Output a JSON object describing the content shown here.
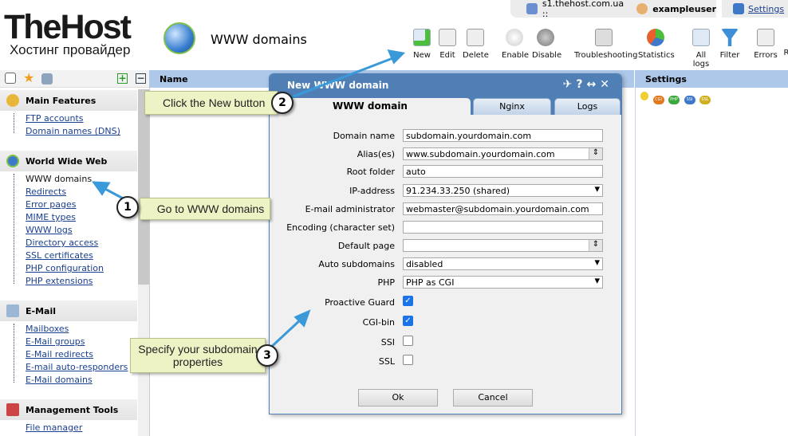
{
  "topbar": {
    "server": "s1.thehost.com.ua ::",
    "user": "exampleuser",
    "settings": "Settings"
  },
  "logo": {
    "name": "TheHost",
    "tagline": "Хостинг провайдер"
  },
  "page_title": "WWW domains",
  "toolbar": [
    "New",
    "Edit",
    "Delete",
    "Enable",
    "Disable",
    "Troubleshooting",
    "Statistics",
    "All logs",
    "Filter",
    "Errors",
    "R"
  ],
  "sidebar": {
    "sections": [
      {
        "title": "Main Features",
        "items": [
          "FTP accounts",
          "Domain names (DNS)"
        ]
      },
      {
        "title": "World Wide Web",
        "items": [
          "WWW domains",
          "Redirects",
          "Error pages",
          "MIME types",
          "WWW logs",
          "Directory access",
          "SSL certificates",
          "PHP configuration",
          "PHP extensions"
        ]
      },
      {
        "title": "E-Mail",
        "items": [
          "Mailboxes",
          "E-Mail groups",
          "E-Mail redirects",
          "E-mail auto-responders",
          "E-Mail domains"
        ]
      },
      {
        "title": "Management Tools",
        "items": [
          "File manager"
        ]
      }
    ]
  },
  "table": {
    "column": "Name"
  },
  "settings_panel": {
    "title": "Settings",
    "chips": [
      "CGI",
      "PHP",
      "SSI",
      "SSL"
    ]
  },
  "dialog": {
    "title": "New WWW domain",
    "tabs": [
      "WWW domain",
      "Nginx",
      "Logs"
    ],
    "fields": {
      "domain_name": {
        "label": "Domain name",
        "value": "subdomain.yourdomain.com"
      },
      "aliases": {
        "label": "Alias(es)",
        "value": "www.subdomain.yourdomain.com"
      },
      "root": {
        "label": "Root folder",
        "value": "auto"
      },
      "ip": {
        "label": "IP-address",
        "value": "91.234.33.250 (shared)"
      },
      "email": {
        "label": "E-mail administrator",
        "value": "webmaster@subdomain.yourdomain.com"
      },
      "encoding": {
        "label": "Encoding (character set)",
        "value": ""
      },
      "default_page": {
        "label": "Default page",
        "value": ""
      },
      "auto_sub": {
        "label": "Auto subdomains",
        "value": "disabled"
      },
      "php": {
        "label": "PHP",
        "value": "PHP as CGI"
      },
      "proactive": {
        "label": "Proactive Guard",
        "checked": true
      },
      "cgi": {
        "label": "CGI-bin",
        "checked": true
      },
      "ssi": {
        "label": "SSI",
        "checked": false
      },
      "ssl": {
        "label": "SSL",
        "checked": false
      }
    },
    "ok": "Ok",
    "cancel": "Cancel"
  },
  "callouts": [
    {
      "num": "1",
      "text": "Go to WWW domains"
    },
    {
      "num": "2",
      "text": "Click the New button"
    },
    {
      "num": "3",
      "text": "Specify your subdomain properties"
    }
  ]
}
